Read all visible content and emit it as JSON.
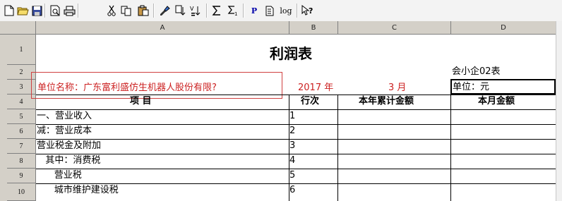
{
  "toolbar": {
    "buttons": [
      {
        "name": "new-icon"
      },
      {
        "name": "open-icon"
      },
      {
        "name": "save-icon"
      },
      {
        "name": "print-preview-icon"
      },
      {
        "name": "print-icon"
      },
      {
        "name": "cut-icon"
      },
      {
        "name": "copy-icon"
      },
      {
        "name": "paste-icon"
      },
      {
        "name": "format-painter-icon"
      },
      {
        "name": "fill-down-icon"
      },
      {
        "name": "sort-icon"
      },
      {
        "name": "sum-icon"
      },
      {
        "name": "subtotal-icon"
      },
      {
        "name": "p-button",
        "text": "P"
      },
      {
        "name": "page-icon"
      },
      {
        "name": "log-button",
        "text": "log"
      },
      {
        "name": "help-pointer-icon"
      }
    ]
  },
  "columns": [
    "A",
    "B",
    "C",
    "D"
  ],
  "rows": [
    "1",
    "2",
    "3",
    "4",
    "5",
    "6",
    "7",
    "8",
    "9",
    "10"
  ],
  "report": {
    "title": "利润表",
    "form_code": "会小企02表",
    "company": "单位名称：广东富利盛仿生机器人股份有限?",
    "year": "2017 年",
    "month": "3 月",
    "unit": "单位：元",
    "headers": {
      "item": "项          目",
      "line_no": "行次",
      "ytd": "本年累计金额",
      "month": "本月金额"
    },
    "items": [
      {
        "label": "一、营业收入",
        "line": "1"
      },
      {
        "label": "减：营业成本",
        "line": "2"
      },
      {
        "label": "营业税金及附加",
        "line": "3"
      },
      {
        "label": "   其中：消费税",
        "line": "4"
      },
      {
        "label": "      营业税",
        "line": "5"
      },
      {
        "label": "      城市维护建设税",
        "line": "6"
      }
    ]
  },
  "colors": {
    "header_bg": "#d4d0c8",
    "grid": "#000000",
    "red_text": "#cc2222",
    "toolbar_bg": "#f3f3f3"
  }
}
